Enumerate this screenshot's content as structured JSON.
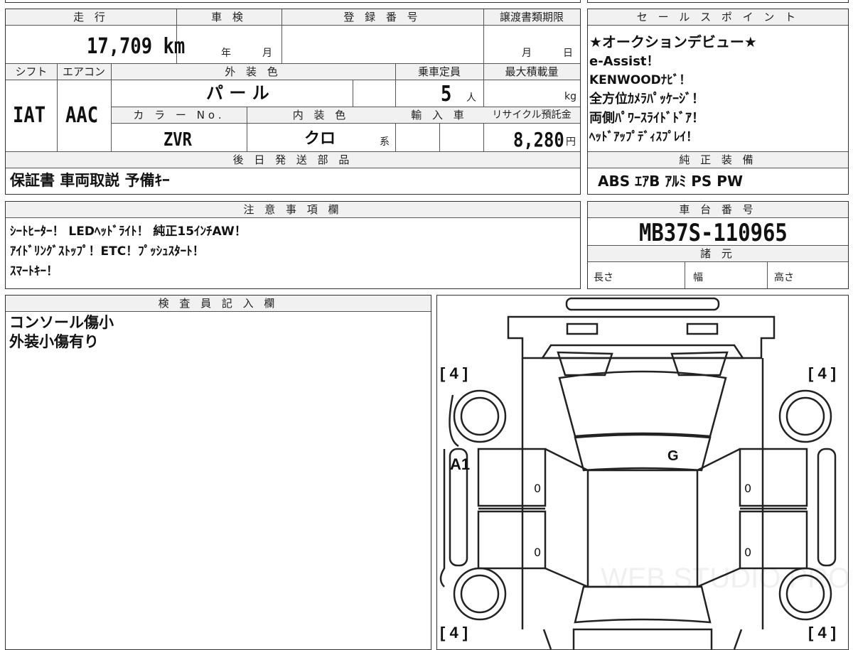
{
  "top_box": {
    "headers": {
      "mileage": "走 行",
      "shaken": "車 検",
      "registration": "登 録 番 号",
      "transfer_deadline": "譲渡書類期限"
    },
    "mileage_value": "17,709 km",
    "shaken_year": "年",
    "shaken_month": "月",
    "transfer_month": "月",
    "transfer_day": "日",
    "headers2": {
      "shift": "シフト",
      "aircon": "エアコン",
      "exterior_color": "外 装 色",
      "capacity": "乗車定員",
      "max_load": "最大積載量"
    },
    "shift_value": "IAT",
    "aircon_value": "AAC",
    "exterior_color_value": "パ ー ル",
    "capacity_value": "5",
    "capacity_unit": "人",
    "load_unit": "kg",
    "headers3": {
      "color_no": "カ ラ ー No.",
      "interior_color": "内 装 色",
      "import": "輸 入 車",
      "recycle": "リサイクル預託金"
    },
    "color_no_value": "ZVR",
    "interior_color_value": "クロ",
    "interior_suffix": "系",
    "recycle_value": "8,280",
    "recycle_unit": "円",
    "later_parts_header": "後 日 発 送 部 品",
    "later_parts_value": "保証書  車両取説  予備ｷｰ"
  },
  "sales_point": {
    "header": "セ ー ル ス ポ イ ン ト",
    "lines": [
      "★オークションデビュー★",
      "e-Assist！",
      "KENWOODﾅﾋﾞ！",
      "全方位ｶﾒﾗﾊﾟｯｹｰｼﾞ！",
      "両側ﾊﾟﾜｰｽﾗｲﾄﾞﾄﾞｱ！",
      "ﾍｯﾄﾞｱｯﾌﾟﾃﾞｨｽﾌﾟﾚｲ！"
    ],
    "equipment_header": "純 正 装 備",
    "equipment_value": "ABS  ｴｱB  ｱﾙﾐ  PS  PW"
  },
  "notes": {
    "header": "注 意 事 項 欄",
    "lines": [
      "ｼｰﾄﾋｰﾀｰ！ LEDﾍｯﾄﾞﾗｲﾄ！ 純正15ｲﾝﾁAW！",
      "ｱｲﾄﾞﾘﾝｸﾞｽﾄｯﾌﾟ！ETC！ﾌﾟｯｼｭｽﾀｰﾄ！",
      "ｽﾏｰﾄｷｰ！"
    ]
  },
  "chassis": {
    "header": "車 台 番 号",
    "value": "MB37S-110965",
    "spec_header": "諸 元",
    "length_label": "長さ",
    "width_label": "幅",
    "height_label": "高さ"
  },
  "inspector": {
    "header": "検 査 員 記 入 欄",
    "lines": [
      "コンソール傷小",
      "外装小傷有り"
    ]
  },
  "diagram": {
    "tire_tl": "[ 4 ]",
    "tire_tr": "[ 4 ]",
    "tire_bl": "[ 4 ]",
    "tire_br": "[ 4 ]",
    "mark_a1": "A1",
    "mark_g": "G",
    "door_l1": "0",
    "door_l2": "0",
    "door_r1": "0",
    "door_r2": "0",
    "watermark": "WEB STUDIO PRO"
  }
}
